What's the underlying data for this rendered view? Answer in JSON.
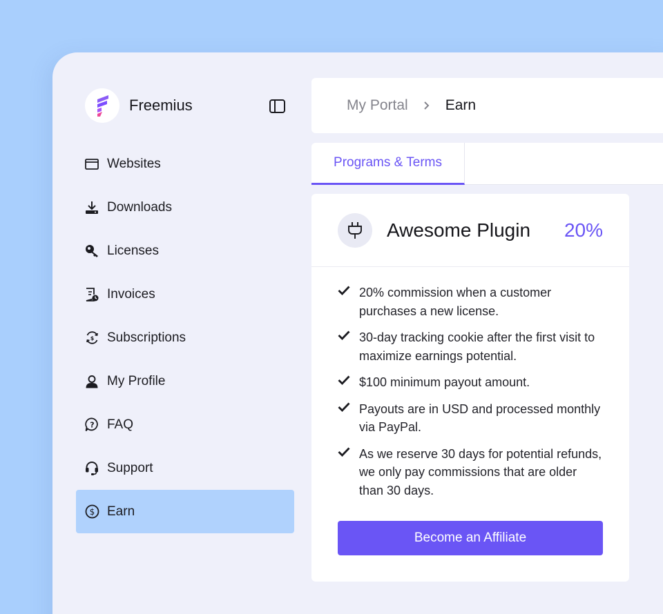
{
  "brand": {
    "name": "Freemius",
    "logo_icon": "freemius-logo-icon"
  },
  "sidebar": {
    "collapse_icon": "sidebar-toggle-icon",
    "items": [
      {
        "label": "Websites",
        "icon": "browser-window-icon",
        "active": false
      },
      {
        "label": "Downloads",
        "icon": "download-icon",
        "active": false
      },
      {
        "label": "Licenses",
        "icon": "key-icon",
        "active": false
      },
      {
        "label": "Invoices",
        "icon": "invoice-icon",
        "active": false
      },
      {
        "label": "Subscriptions",
        "icon": "subscription-cycle-icon",
        "active": false
      },
      {
        "label": "My Profile",
        "icon": "user-icon",
        "active": false
      },
      {
        "label": "FAQ",
        "icon": "question-bubble-icon",
        "active": false
      },
      {
        "label": "Support",
        "icon": "headset-icon",
        "active": false
      },
      {
        "label": "Earn",
        "icon": "dollar-circle-icon",
        "active": true
      }
    ]
  },
  "breadcrumb": {
    "parent": "My Portal",
    "current": "Earn"
  },
  "tabs": [
    {
      "label": "Programs & Terms",
      "active": true
    }
  ],
  "program": {
    "icon": "plug-icon",
    "name": "Awesome Plugin",
    "commission_rate": "20%",
    "terms": [
      "20% commission when a customer purchases a new license.",
      "30-day tracking cookie after the first visit to maximize earnings potential.",
      "$100 minimum payout amount.",
      "Payouts are in USD and processed monthly via PayPal.",
      "As we reserve 30 days for potential refunds, we only pay commissions that are older than 30 days."
    ],
    "cta_label": "Become an Affiliate"
  },
  "colors": {
    "background": "#a9cffd",
    "window": "#eff0fa",
    "accent": "#6a55f5",
    "active_nav": "#b0d2fd"
  }
}
